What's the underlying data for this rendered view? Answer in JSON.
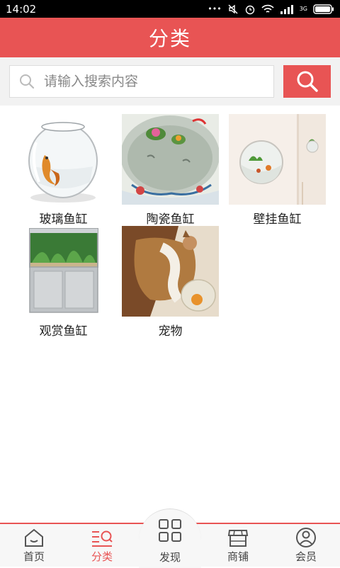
{
  "status_bar": {
    "time": "14:02",
    "dots": "•••",
    "network": "3G"
  },
  "header": {
    "title": "分类"
  },
  "search": {
    "placeholder": "请输入搜索内容"
  },
  "categories": [
    {
      "label": "玻璃鱼缸"
    },
    {
      "label": "陶瓷鱼缸"
    },
    {
      "label": "壁挂鱼缸"
    },
    {
      "label": "观赏鱼缸"
    },
    {
      "label": "宠物"
    }
  ],
  "bottom_nav": {
    "items": [
      {
        "label": "首页"
      },
      {
        "label": "分类"
      },
      {
        "label": "发现"
      },
      {
        "label": "商铺"
      },
      {
        "label": "会员"
      }
    ],
    "active_index": 1
  },
  "colors": {
    "accent": "#e85454",
    "text": "#222222",
    "nav_text": "#444444"
  }
}
